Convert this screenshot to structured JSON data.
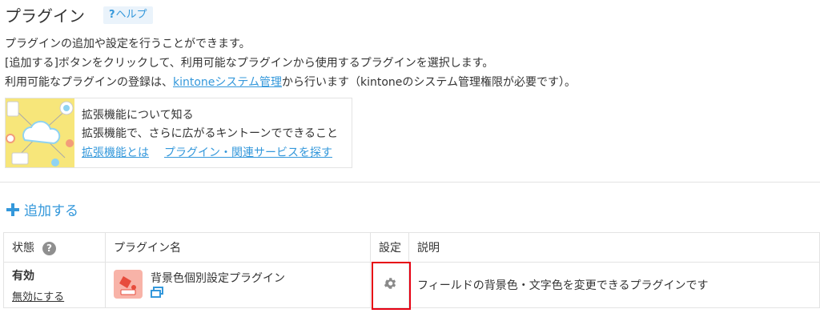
{
  "header": {
    "title": "プラグイン",
    "help_label": "ヘルプ",
    "help_mark": "?"
  },
  "description": {
    "line1": "プラグインの追加や設定を行うことができます。",
    "line2": "[追加する]ボタンをクリックして、利用可能なプラグインから使用するプラグインを選択します。",
    "line3_prefix": "利用可能なプラグインの登録は、",
    "line3_link": "kintoneシステム管理",
    "line3_suffix": "から行います（kintoneのシステム管理権限が必要です）。"
  },
  "extension_card": {
    "title": "拡張機能について知る",
    "subtitle": "拡張機能で、さらに広がるキントーンでできること",
    "link1": "拡張機能とは",
    "link2": "プラグイン・関連サービスを探す"
  },
  "add_button": {
    "label": "追加する",
    "icon": "plus-icon"
  },
  "table": {
    "columns": [
      "状態",
      "プラグイン名",
      "設定",
      "説明"
    ],
    "rows": [
      {
        "status": "有効",
        "status_action": "無効にする",
        "plugin_name": "背景色個別設定プラグイン",
        "settings_icon": "gear-icon",
        "description": "フィールドの背景色・文字色を変更できるプラグインです"
      }
    ]
  },
  "colors": {
    "link": "#3498db",
    "highlight": "#e60012",
    "plugin_icon_bg": "#f8b3a8"
  }
}
